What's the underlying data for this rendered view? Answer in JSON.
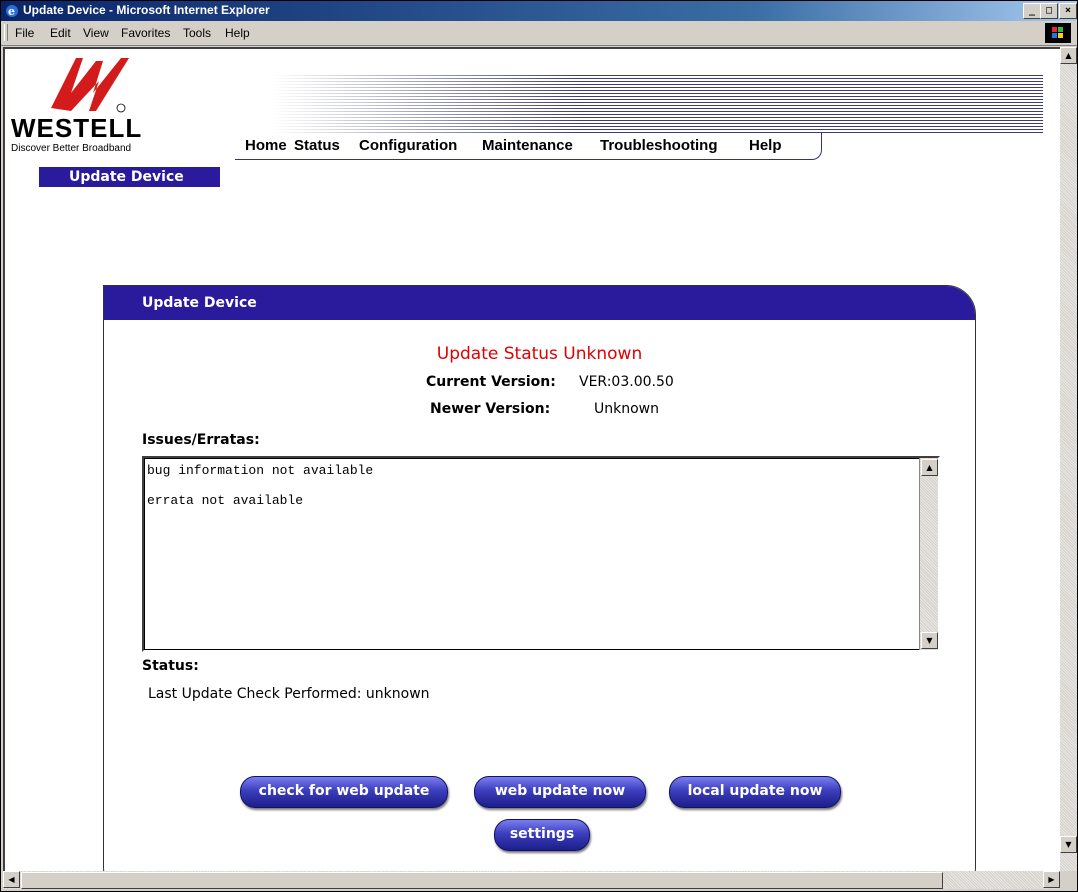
{
  "window": {
    "title": "Update Device - Microsoft Internet Explorer"
  },
  "menubar": {
    "items": [
      "File",
      "Edit",
      "View",
      "Favorites",
      "Tools",
      "Help"
    ]
  },
  "logo": {
    "wordmark": "WESTELL",
    "tagline": "Discover  Better Broadband",
    "registered": "®"
  },
  "nav": {
    "items": [
      "Home",
      "Status",
      "Configuration",
      "Maintenance",
      "Troubleshooting",
      "Help"
    ]
  },
  "section_tag": "Update Device",
  "panel": {
    "header": "Update Device",
    "update_status": "Update Status Unknown",
    "current_version_label": "Current Version:",
    "current_version_value": "VER:03.00.50",
    "newer_version_label": "Newer Version:",
    "newer_version_value": "Unknown",
    "issues_label": "Issues/Erratas:",
    "issues_text": "bug information not available\n\nerrata not available",
    "status_label": "Status:",
    "status_text": "Last Update Check Performed: unknown"
  },
  "buttons": {
    "check_web_update": "check for web update",
    "web_update_now": "web update now",
    "local_update_now": "local update now",
    "settings": "settings"
  },
  "colors": {
    "accent": "#2a1a9c",
    "status_red": "#e00000"
  }
}
